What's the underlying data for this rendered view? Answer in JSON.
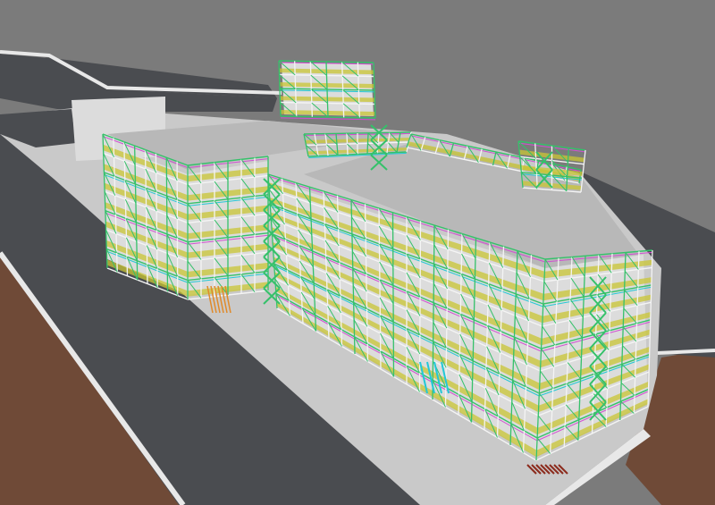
{
  "scene": {
    "kind": "3d-render",
    "subject": "building-with-scaffolding",
    "colors": {
      "sky": "#7b7b7b",
      "road": "#4a4c50",
      "pavement": "#c9c9c9",
      "curb": "#e8e8e8",
      "soil": "#6f4a37",
      "roof": "#b8b8b8",
      "wall": "#dcdcdc",
      "scaffold_green": "#35c16a",
      "scaffold_white": "#f4f4f4",
      "scaffold_yellow": "#c9c534",
      "scaffold_magenta": "#d24fd2",
      "scaffold_cyan": "#22c8d6",
      "scaffold_orange": "#e08a2a",
      "scaffold_red": "#8c2b1d"
    },
    "labels": []
  }
}
